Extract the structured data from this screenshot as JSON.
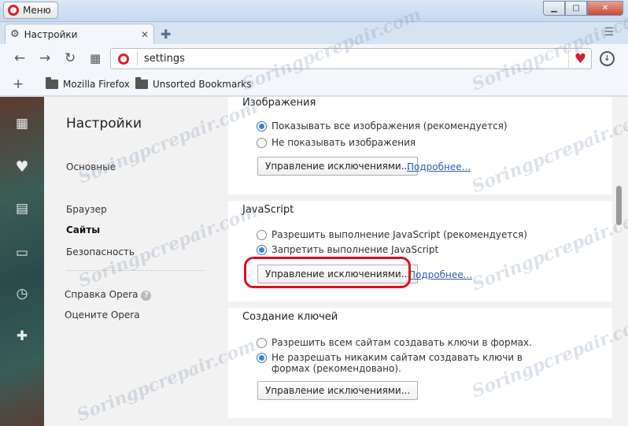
{
  "window": {
    "menu_label": "Меню"
  },
  "tab": {
    "title": "Настройки"
  },
  "address": {
    "url": "settings"
  },
  "bookmarks": [
    {
      "label": "Mozilla Firefox"
    },
    {
      "label": "Unsorted Bookmarks"
    }
  ],
  "sidebar": {
    "title": "Настройки",
    "items": [
      {
        "label": "Основные"
      },
      {
        "label": "Браузер"
      },
      {
        "label": "Сайты"
      },
      {
        "label": "Безопасность"
      }
    ],
    "help_label": "Справка Opera",
    "rate_label": "Оцените Opera"
  },
  "images": {
    "title": "Изображения",
    "options": [
      {
        "label": "Показывать все изображения (рекомендуется)",
        "checked": true
      },
      {
        "label": "Не показывать изображения",
        "checked": false
      }
    ],
    "manage_button": "Управление исключениями...",
    "more_link": "Подробнее..."
  },
  "javascript": {
    "title": "JavaScript",
    "options": [
      {
        "label": "Разрешить выполнение JavaScript (рекомендуется)",
        "checked": false
      },
      {
        "label": "Запретить выполнение JavaScript",
        "checked": true
      }
    ],
    "manage_button": "Управление исключениями...",
    "more_link": "Подробнее..."
  },
  "keygen": {
    "title": "Создание ключей",
    "options": [
      {
        "label": "Разрешить всем сайтам создавать ключи в формах.",
        "checked": false
      },
      {
        "label": "Не разрешать никаким сайтам создавать ключи в формах (рекомендовано).",
        "checked": true
      }
    ],
    "manage_button": "Управление исключениями..."
  },
  "watermark": "Soringpcrepair.com",
  "colors": {
    "accent": "#3b83d6",
    "link": "#2b5fb8",
    "highlight": "#e0101a",
    "opera_red": "#e0202c"
  }
}
